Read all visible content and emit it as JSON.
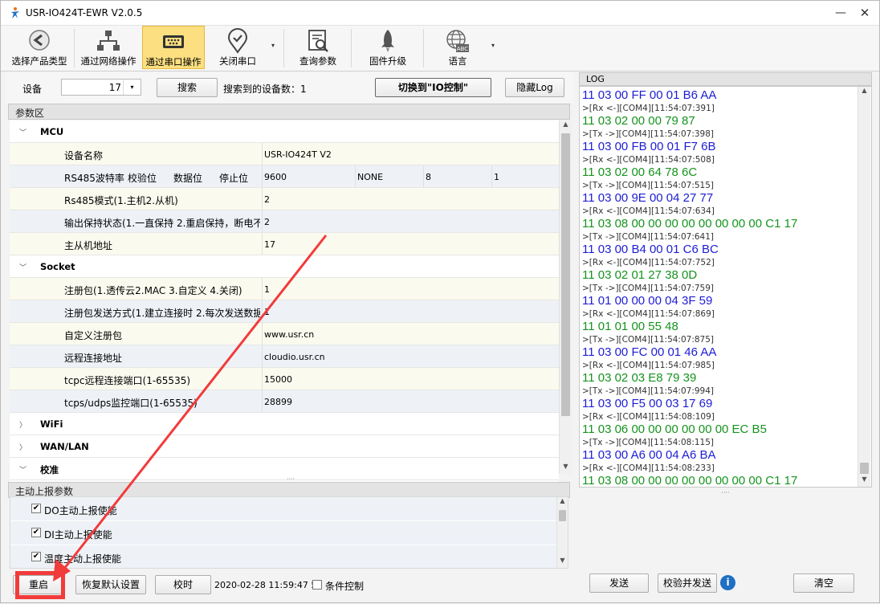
{
  "window": {
    "title": "USR-IO424T-EWR V2.0.5",
    "min": "—",
    "max": "▢",
    "close": "✕"
  },
  "toolbar": {
    "items": [
      {
        "label": "选择产品类型",
        "icon": "back-arrow-icon"
      },
      {
        "label": "通过网络操作",
        "icon": "network-icon"
      },
      {
        "label": "通过串口操作",
        "icon": "serial-port-icon"
      },
      {
        "label": "关闭串口",
        "icon": "location-check-icon"
      },
      {
        "label": "查询参数",
        "icon": "search-document-icon"
      },
      {
        "label": "固件升级",
        "icon": "rocket-icon"
      },
      {
        "label": "语言",
        "icon": "globe-abc-icon"
      }
    ],
    "dropdown": "▾"
  },
  "device_bar": {
    "device_label": "设备",
    "device_value": "17",
    "search_button": "搜索",
    "found_text": "搜索到的设备数：1",
    "switch_button": "切换到\"IO控制\"",
    "hide_log_button": "隐藏Log"
  },
  "params": {
    "header": "参数区",
    "mcu": {
      "title": "MCU",
      "device_name_label": "设备名称",
      "device_name_value": "USR-IO424T V2",
      "rs485_labels": [
        "RS485波特率",
        "校验位",
        "数据位",
        "停止位"
      ],
      "rs485_values": [
        "9600",
        "NONE",
        "8",
        "1"
      ],
      "mode_label": "Rs485模式(1.主机2.从机)",
      "mode_value": "2",
      "hold_label": "输出保持状态(1.一直保持 2.重启保持，断电不",
      "hold_value": "2",
      "addr_label": "主从机地址",
      "addr_value": "17"
    },
    "socket": {
      "title": "Socket",
      "reg_label": "注册包(1.透传云2.MAC 3.自定义 4.关闭)",
      "reg_value": "1",
      "reg_send_label": "注册包发送方式(1.建立连接时 2.每次发送数据",
      "reg_send_value": "1",
      "custom_label": "自定义注册包",
      "custom_value": "www.usr.cn",
      "remote_label": "远程连接地址",
      "remote_value": "cloudio.usr.cn",
      "tcpc_label": "tcpc远程连接端口(1-65535)",
      "tcpc_value": "15000",
      "tcps_label": "tcps/udps监控端口(1-65535)",
      "tcps_value": "28899"
    },
    "wifi": "WiFi",
    "wan": "WAN/LAN",
    "calib": "校准"
  },
  "report": {
    "header": "主动上报参数",
    "items": [
      "DO主动上报使能",
      "DI主动上报使能",
      "温度主动上报使能"
    ]
  },
  "bottom": {
    "restart": "重启",
    "restore": "恢复默认设置",
    "timesync": "校时",
    "timestamp": "2020-02-28 11:59:47 5",
    "cond_label": "条件控制"
  },
  "log": {
    "header": "LOG",
    "lines": [
      {
        "t": "11 03 00 FF 00 01 B6 AA",
        "k": "tx"
      },
      {
        "t": ">[Rx <-][COM4][11:54:07:391]",
        "k": "s"
      },
      {
        "t": "11 03 02 00 00 79 87",
        "k": "rx"
      },
      {
        "t": ">[Tx ->][COM4][11:54:07:398]",
        "k": "s"
      },
      {
        "t": "11 03 00 FB 00 01 F7 6B",
        "k": "tx"
      },
      {
        "t": ">[Rx <-][COM4][11:54:07:508]",
        "k": "s"
      },
      {
        "t": "11 03 02 00 64 78 6C",
        "k": "rx"
      },
      {
        "t": ">[Tx ->][COM4][11:54:07:515]",
        "k": "s"
      },
      {
        "t": "11 03 00 9E 00 04 27 77",
        "k": "tx"
      },
      {
        "t": ">[Rx <-][COM4][11:54:07:634]",
        "k": "s"
      },
      {
        "t": "11 03 08 00 00 00 00 00 00 00 00 C1 17",
        "k": "rx"
      },
      {
        "t": ">[Tx ->][COM4][11:54:07:641]",
        "k": "s"
      },
      {
        "t": "11 03 00 B4 00 01 C6 BC",
        "k": "tx"
      },
      {
        "t": ">[Rx <-][COM4][11:54:07:752]",
        "k": "s"
      },
      {
        "t": "11 03 02 01 27 38 0D",
        "k": "rx"
      },
      {
        "t": ">[Tx ->][COM4][11:54:07:759]",
        "k": "s"
      },
      {
        "t": "11 01 00 00 00 04 3F 59",
        "k": "tx"
      },
      {
        "t": ">[Rx <-][COM4][11:54:07:869]",
        "k": "s"
      },
      {
        "t": "11 01 01 00 55 48",
        "k": "rx"
      },
      {
        "t": ">[Tx ->][COM4][11:54:07:875]",
        "k": "s"
      },
      {
        "t": "11 03 00 FC 00 01 46 AA",
        "k": "tx"
      },
      {
        "t": ">[Rx <-][COM4][11:54:07:985]",
        "k": "s"
      },
      {
        "t": "11 03 02 03 E8 79 39",
        "k": "rx"
      },
      {
        "t": ">[Tx ->][COM4][11:54:07:994]",
        "k": "s"
      },
      {
        "t": "11 03 00 F5 00 03 17 69",
        "k": "tx"
      },
      {
        "t": ">[Rx <-][COM4][11:54:08:109]",
        "k": "s"
      },
      {
        "t": "11 03 06 00 00 00 00 00 00 EC B5",
        "k": "rx"
      },
      {
        "t": ">[Tx ->][COM4][11:54:08:115]",
        "k": "s"
      },
      {
        "t": "11 03 00 A6 00 04 A6 BA",
        "k": "tx"
      },
      {
        "t": ">[Rx <-][COM4][11:54:08:233]",
        "k": "s"
      },
      {
        "t": "11 03 08 00 00 00 00 00 00 00 00 C1 17",
        "k": "rx"
      }
    ],
    "send": "发送",
    "check_send": "校验并发送",
    "info": "i",
    "clear": "清空"
  },
  "colors": {
    "tx": "#1d1dd4",
    "rx": "#16941f",
    "highlight": "#f23b3b",
    "active_tool": "#fcdf80"
  }
}
